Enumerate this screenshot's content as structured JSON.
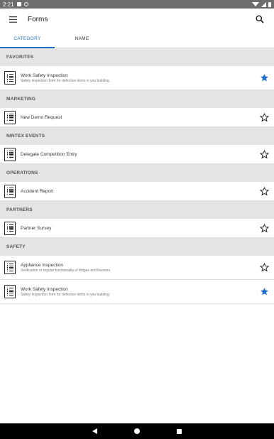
{
  "status_bar": {
    "time": "2:21"
  },
  "app_bar": {
    "title": "Forms",
    "menu_icon": "hamburger-menu-icon",
    "search_icon": "search-icon"
  },
  "tabs": [
    {
      "label": "CATEGORY",
      "active": true
    },
    {
      "label": "NAME",
      "active": false
    }
  ],
  "sections": [
    {
      "header": "FAVORITES",
      "forms": [
        {
          "title": "Work Safety Inspection",
          "description": "Safety inspection form for defective items in you building",
          "favorite": true
        }
      ]
    },
    {
      "header": "MARKETING",
      "forms": [
        {
          "title": "New Demo Request",
          "description": "",
          "favorite": false
        }
      ]
    },
    {
      "header": "NINTEX EVENTS",
      "forms": [
        {
          "title": "Delegate Competition Entry",
          "description": "",
          "favorite": false
        }
      ]
    },
    {
      "header": "OPERATIONS",
      "forms": [
        {
          "title": "Accident Report",
          "description": "",
          "favorite": false
        }
      ]
    },
    {
      "header": "PARTNERS",
      "forms": [
        {
          "title": "Partner Survey",
          "description": "",
          "favorite": false
        }
      ]
    },
    {
      "header": "SAFETY",
      "forms": [
        {
          "title": "Appliance Inspection",
          "description": "Verification or regular functionality of fridges and freezers",
          "favorite": false
        },
        {
          "title": "Work Safety Inspection",
          "description": "Safety inspection form for defective items in you building",
          "favorite": true
        }
      ]
    }
  ],
  "colors": {
    "accent": "#1e6fc9",
    "section_bg": "#e4e4e4",
    "status_bar": "#6d6d6d",
    "nav_bar": "#000000"
  }
}
